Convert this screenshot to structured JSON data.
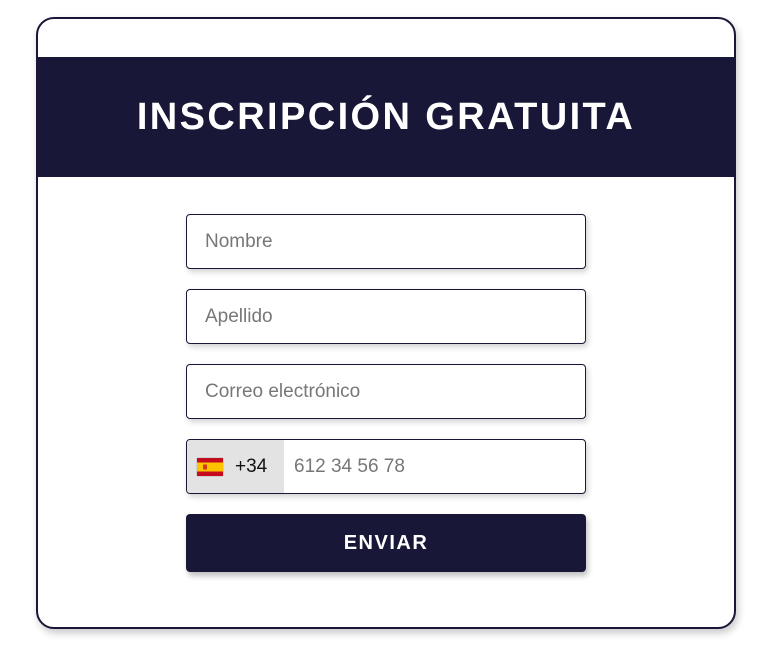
{
  "form": {
    "title": "INSCRIPCIÓN GRATUITA",
    "fields": {
      "first_name": {
        "placeholder": "Nombre",
        "value": ""
      },
      "last_name": {
        "placeholder": "Apellido",
        "value": ""
      },
      "email": {
        "placeholder": "Correo electrónico",
        "value": ""
      },
      "phone": {
        "country_flag": "spain-flag-icon",
        "dial_code": "+34",
        "placeholder": "612 34 56 78",
        "value": ""
      }
    },
    "submit_label": "ENVIAR"
  },
  "colors": {
    "primary": "#181737",
    "background": "#ffffff",
    "country_selector_bg": "#e3e3e3",
    "placeholder": "#777777",
    "flag_red": "#c60b1e",
    "flag_yellow": "#ffc400"
  }
}
